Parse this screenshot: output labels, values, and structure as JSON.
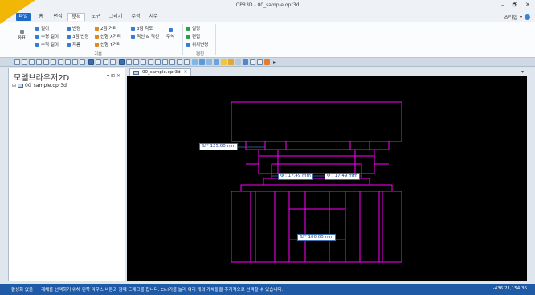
{
  "window": {
    "title": "OPR3D - 00_sample.opr3d",
    "controls": [
      "–",
      "🗗",
      "✕"
    ]
  },
  "menu": {
    "items": [
      "파일",
      "홈",
      "편집",
      "분석",
      "도구",
      "그리기",
      "수정",
      "치수"
    ],
    "active": "분석",
    "style_label": "스타일",
    "help_icon": "help-icon"
  },
  "ribbon": {
    "coord_button": "좌표",
    "length": "길이",
    "horizontal_length": "수평 길이",
    "vertical_length": "수직 길이",
    "radius": "반경",
    "three_point_radius": "3점 반경",
    "diameter": "지름",
    "two_point_distance": "2점 거리",
    "line_x_distance": "선형 X거리",
    "line_y_distance": "선형 Y거리",
    "three_point_angle": "3점 각도",
    "line_to_line": "직선 & 직선",
    "annotation": "주석",
    "settings": "설정",
    "edit": "편집",
    "move_position": "위치변경",
    "group_basic": "기본",
    "group_edit": "편집"
  },
  "sidebar": {
    "title": "모델브라우저2D",
    "pin": "▾ ⊞ ✕",
    "tree_expander": "⊟",
    "root_item": "00_sample.opr3d"
  },
  "document_tab": {
    "label": "00_sample.opr3d",
    "close": "✕"
  },
  "dimensions": {
    "top_width": "Δ!* 125.00 mm",
    "diameter_left": "Φ : 17.49 mm",
    "diameter_right": "Φ : 17.49 mm",
    "bottom_width": "Δ!* 100.00 mm"
  },
  "status": {
    "item1": "활성화 없음",
    "item2": "개체를 선택하기 위해 왼쪽 마우스 버튼과 함께 드래그를 합니다. Ctrl키를 눌러 여러 개의 개체들을 추가적으로 선택할 수 있습니다.",
    "coordinates": "-436.21,154.36"
  },
  "colors": {
    "accent": "#1e6bc5",
    "canvas": "#000000",
    "geometry": "#ff00ff",
    "dimension_line": "#3b6fb0"
  }
}
